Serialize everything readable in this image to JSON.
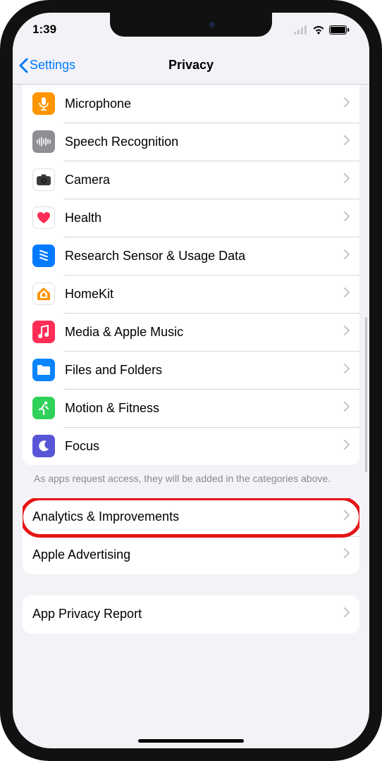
{
  "status": {
    "time": "1:39"
  },
  "nav": {
    "back_label": "Settings",
    "title": "Privacy"
  },
  "group1": {
    "items": [
      {
        "label": "Microphone",
        "icon": "microphone-icon",
        "bg": "bg-orange"
      },
      {
        "label": "Speech Recognition",
        "icon": "speech-icon",
        "bg": "bg-gray"
      },
      {
        "label": "Camera",
        "icon": "camera-icon",
        "bg": "bg-whiteb"
      },
      {
        "label": "Health",
        "icon": "health-icon",
        "bg": "bg-whiteb"
      },
      {
        "label": "Research Sensor & Usage Data",
        "icon": "research-icon",
        "bg": "bg-blue"
      },
      {
        "label": "HomeKit",
        "icon": "homekit-icon",
        "bg": "bg-whiteb"
      },
      {
        "label": "Media & Apple Music",
        "icon": "music-icon",
        "bg": "bg-pink"
      },
      {
        "label": "Files and Folders",
        "icon": "folder-icon",
        "bg": "bg-blue2"
      },
      {
        "label": "Motion & Fitness",
        "icon": "fitness-icon",
        "bg": "bg-green"
      },
      {
        "label": "Focus",
        "icon": "focus-icon",
        "bg": "bg-purple"
      }
    ],
    "footer": "As apps request access, they will be added in the categories above."
  },
  "group2": {
    "items": [
      {
        "label": "Analytics & Improvements"
      },
      {
        "label": "Apple Advertising"
      }
    ]
  },
  "group3": {
    "items": [
      {
        "label": "App Privacy Report"
      }
    ]
  }
}
